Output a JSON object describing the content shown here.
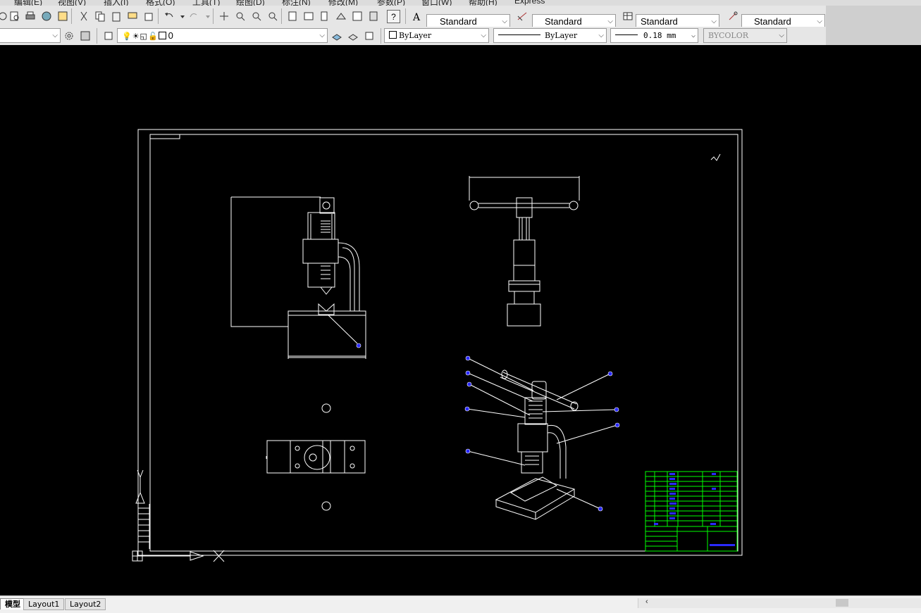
{
  "menu": [
    "编辑(E)",
    "视图(V)",
    "插入(I)",
    "格式(O)",
    "工具(T)",
    "绘图(D)",
    "标注(N)",
    "修改(M)",
    "参数(P)",
    "窗口(W)",
    "帮助(H)",
    "Express"
  ],
  "toolbar1": {
    "text_style": "Standard",
    "dim_style": "Standard",
    "table_style": "Standard",
    "multileader_style": "Standard",
    "help_button": "?"
  },
  "toolbar2": {
    "layer": "0",
    "color": "ByLayer",
    "linetype": "ByLayer",
    "lineweight": "0.18 mm",
    "plotstyle": "BYCOLOR"
  },
  "tabs": {
    "model": "模型",
    "layout1": "Layout1",
    "layout2": "Layout2"
  },
  "colors": {
    "canvas_bg": "#000000",
    "drawing_lines": "#ffffff",
    "title_block": "#00ff00",
    "title_text": "#0000ff",
    "leader_dot": "#3b3bff"
  }
}
